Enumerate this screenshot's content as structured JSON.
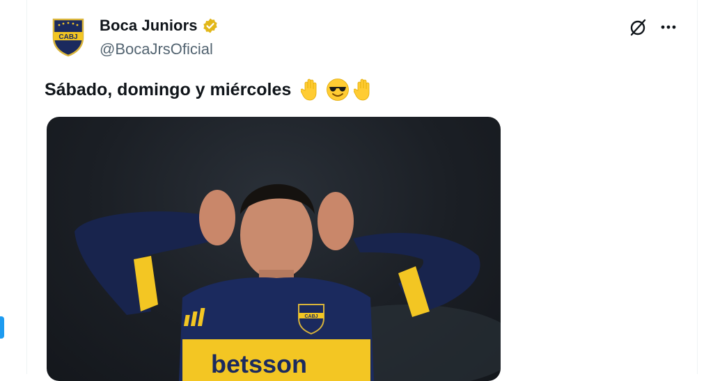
{
  "tweet": {
    "author": {
      "display_name": "Boca Juniors",
      "handle": "@BocaJrsOficial",
      "verified": true,
      "avatar_crest_text": "CABJ"
    },
    "text": "Sábado, domingo y miércoles",
    "emojis": [
      "raised-hand",
      "smiling-face-with-sunglasses",
      "raised-hand"
    ],
    "media": {
      "type": "photo",
      "jersey_sponsor": "betsson",
      "jersey_crest_text": "CABJ"
    }
  },
  "icons": {
    "grok": "grok-icon",
    "more": "more-icon",
    "verified": "verified-badge-icon"
  },
  "colors": {
    "name": "#0f1419",
    "handle": "#536471",
    "verified_gold": "#e2b719",
    "boca_blue": "#1b2a5e",
    "boca_gold": "#f3c623",
    "accent_blue": "#1d9bf0"
  }
}
